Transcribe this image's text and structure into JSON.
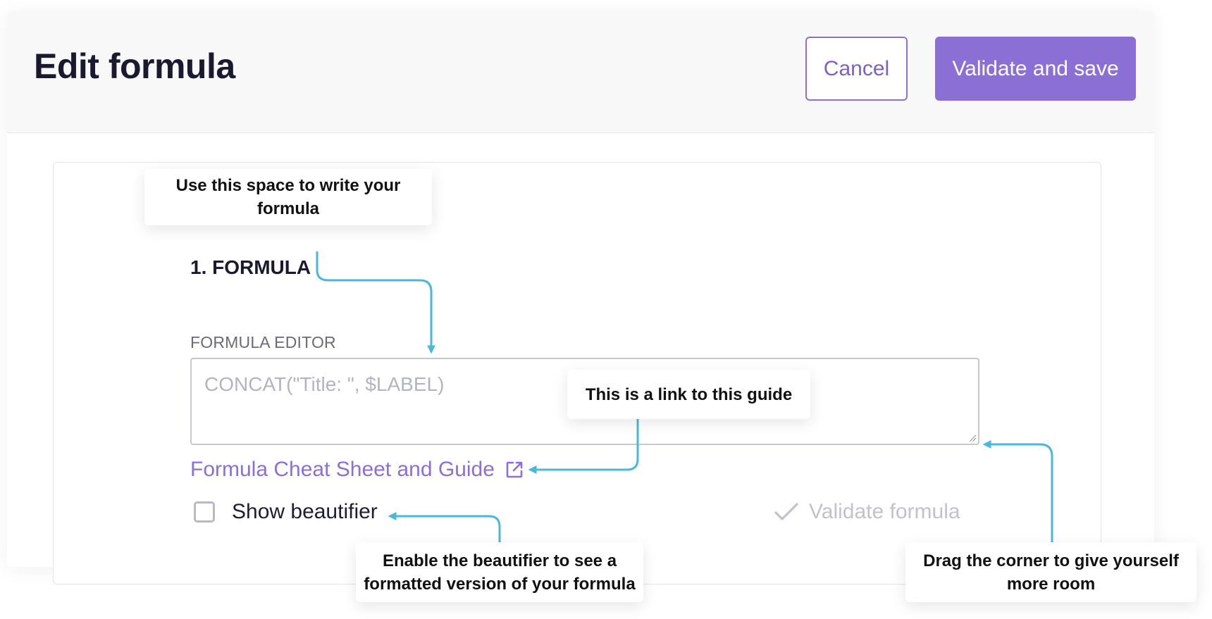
{
  "header": {
    "title": "Edit formula",
    "cancel_label": "Cancel",
    "save_label": "Validate and save"
  },
  "formula_section": {
    "title": "1. FORMULA",
    "editor_label": "FORMULA EDITOR",
    "editor_placeholder": "CONCAT(\"Title: \", $LABEL)",
    "guide_link_label": "Formula Cheat Sheet and Guide",
    "beautifier_label": "Show beautifier",
    "beautifier_checked": false,
    "validate_label": "Validate formula"
  },
  "annotations": {
    "formula_tip": "Use this space to write your formula",
    "guide_tip": "This is a link to this guide",
    "beautifier_tip": "Enable the beautifier to see a formatted version of your formula",
    "drag_tip": "Drag the corner to give yourself more room"
  },
  "icons": {
    "external_link": "external-link-icon",
    "checkmark": "checkmark-icon",
    "resize": "resize-grip-icon"
  },
  "colors": {
    "accent": "#8c6fd5",
    "annotation_arrow": "#4ab8dc",
    "header_bg": "#f8f8f9",
    "disabled_text": "#c2c2ca"
  }
}
